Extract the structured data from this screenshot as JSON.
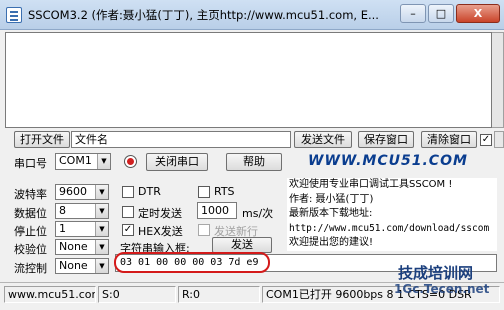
{
  "window": {
    "title": "SSCOM3.2 (作者:聂小猛(丁丁), 主页http://www.mcu51.com, E...",
    "controls": {
      "minimize": "–",
      "maximize": "□",
      "close": "X"
    }
  },
  "file_row": {
    "open_file": "打开文件",
    "file_name": "文件名",
    "send_file": "发送文件",
    "save_window": "保存窗口",
    "clear_window": "清除窗口",
    "hex_display_checked": true
  },
  "port_row": {
    "port_label": "串口号",
    "port_value": "COM1",
    "close_port": "关闭串口",
    "help": "帮助",
    "brand": "WWW.MCU51.COM"
  },
  "settings": {
    "baud_label": "波特率",
    "baud_value": "9600",
    "data_bits_label": "数据位",
    "data_bits_value": "8",
    "stop_bits_label": "停止位",
    "stop_bits_value": "1",
    "parity_label": "校验位",
    "parity_value": "None",
    "flow_label": "流控制",
    "flow_value": "None"
  },
  "options": {
    "dtr": "DTR",
    "rts": "RTS",
    "timed_send": "定时发送",
    "interval_value": "1000",
    "interval_unit": "ms/次",
    "hex_send": "HEX发送",
    "hex_send_checked": true,
    "send_newline": "发送新行",
    "input_label": "字符串输入框:",
    "send": "发送"
  },
  "info_panel": {
    "lines": [
      "欢迎使用专业串口调试工具SSCOM !",
      "作者: 聂小猛(丁丁)",
      "最新版本下载地址:",
      "http://www.mcu51.com/download/sscom",
      "欢迎提出您的建议!"
    ]
  },
  "send_input": {
    "value": "03 01 00 00 00 03 7d e9"
  },
  "status": {
    "site": "www.mcu51.cor",
    "sent": "S:0",
    "received": "R:0",
    "port_state": "COM1已打开  9600bps  8  1  CTS=0 DSR"
  },
  "watermarks": {
    "line1": "技成培训网",
    "line2": "1Gc.Tecen.net"
  }
}
